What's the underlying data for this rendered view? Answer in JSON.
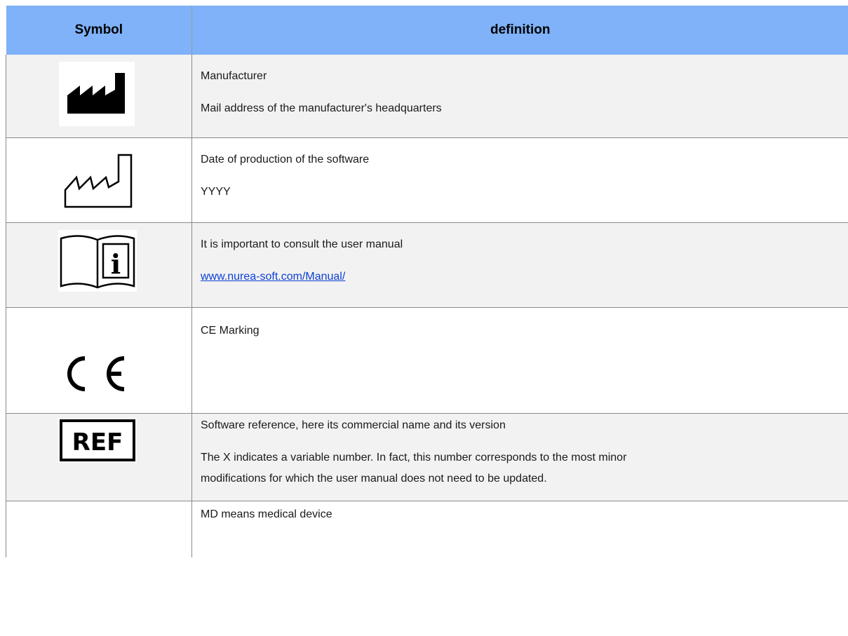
{
  "table": {
    "headers": {
      "symbol": "Symbol",
      "definition": "definition"
    },
    "rows": [
      {
        "icon": "manufacturer-filled-factory-icon",
        "lines": [
          "Manufacturer",
          "Mail address of the manufacturer's headquarters"
        ]
      },
      {
        "icon": "date-of-manufacture-outline-factory-icon",
        "lines": [
          "Date of production of the software",
          "YYYY"
        ]
      },
      {
        "icon": "consult-instructions-book-icon",
        "lines": [
          "It is important to consult the user manual"
        ],
        "link": "www.nurea-soft.com/Manual/"
      },
      {
        "icon": "ce-marking-icon",
        "icon_text": "CE",
        "lines": [
          "CE Marking"
        ]
      },
      {
        "icon": "ref-catalogue-number-icon",
        "icon_text": "REF",
        "lines": [
          "Software reference, here its commercial name and its version",
          "The X indicates a variable number. In fact, this number corresponds to the most minor",
          "modifications for which the user manual does not need to be updated."
        ]
      },
      {
        "icon": "",
        "lines": [
          "MD means medical device"
        ]
      }
    ]
  },
  "colors": {
    "header_bg": "#7fb2f8",
    "row_shade": "#f2f2f2",
    "link": "#0b3fd6",
    "border": "#8a8a8a"
  }
}
